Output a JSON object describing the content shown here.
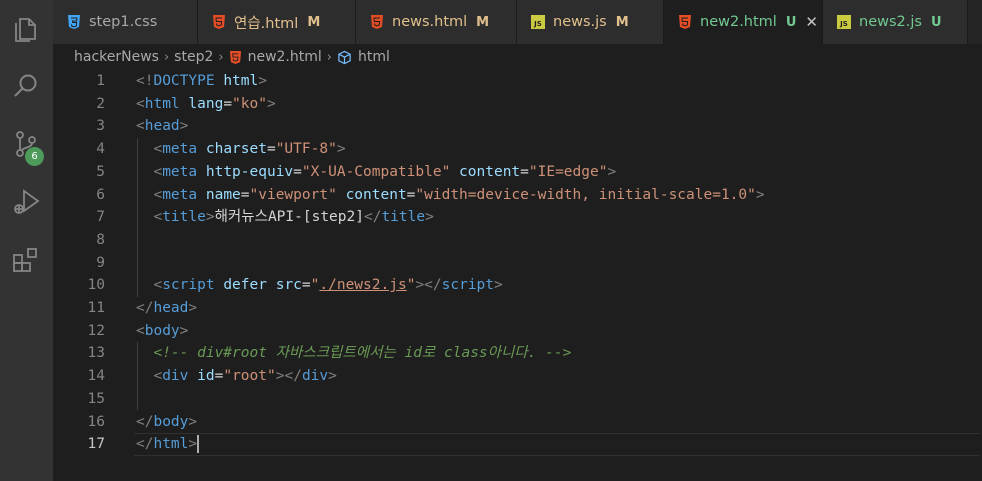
{
  "activity_bar": {
    "items": [
      {
        "icon": "explorer-icon"
      },
      {
        "icon": "search-icon"
      },
      {
        "icon": "source-control-icon",
        "badge": "6"
      },
      {
        "icon": "run-debug-icon"
      },
      {
        "icon": "extensions-icon"
      }
    ]
  },
  "tabs": [
    {
      "name": "step1.css",
      "status": "",
      "type": "css",
      "color": "#a9a9a9"
    },
    {
      "name": "연습.html",
      "status": "M",
      "type": "html",
      "color": "#e2c08d"
    },
    {
      "name": "news.html",
      "status": "M",
      "type": "html",
      "color": "#e2c08d"
    },
    {
      "name": "news.js",
      "status": "M",
      "type": "js",
      "color": "#e2c08d"
    },
    {
      "name": "new2.html",
      "status": "U",
      "type": "html",
      "color": "#73c991",
      "active": true
    },
    {
      "name": "news2.js",
      "status": "U",
      "type": "js",
      "color": "#73c991"
    }
  ],
  "colors": {
    "modified": "#e2c08d",
    "untracked": "#73c991",
    "html_icon": "#e44d26",
    "js_icon": "#cbcb41",
    "css_icon": "#42a5f5"
  },
  "breadcrumb": [
    "hackerNews",
    "step2",
    "new2.html",
    "html"
  ],
  "lines": [
    {
      "n": "1",
      "parts": [
        {
          "c": "p",
          "v": "<!"
        },
        {
          "c": "t",
          "v": "DOCTYPE"
        },
        {
          "c": "x",
          "v": " "
        },
        {
          "c": "a",
          "v": "html"
        },
        {
          "c": "p",
          "v": ">"
        }
      ]
    },
    {
      "n": "2",
      "parts": [
        {
          "c": "p",
          "v": "<"
        },
        {
          "c": "t",
          "v": "html"
        },
        {
          "c": "x",
          "v": " "
        },
        {
          "c": "a",
          "v": "lang"
        },
        {
          "c": "x",
          "v": "="
        },
        {
          "c": "s",
          "v": "\"ko\""
        },
        {
          "c": "p",
          "v": ">"
        }
      ]
    },
    {
      "n": "3",
      "parts": [
        {
          "c": "p",
          "v": "<"
        },
        {
          "c": "t",
          "v": "head"
        },
        {
          "c": "p",
          "v": ">"
        }
      ]
    },
    {
      "n": "4",
      "parts": [
        {
          "c": "x",
          "v": "  "
        },
        {
          "c": "p",
          "v": "<"
        },
        {
          "c": "t",
          "v": "meta"
        },
        {
          "c": "x",
          "v": " "
        },
        {
          "c": "a",
          "v": "charset"
        },
        {
          "c": "x",
          "v": "="
        },
        {
          "c": "s",
          "v": "\"UTF-8\""
        },
        {
          "c": "p",
          "v": ">"
        }
      ]
    },
    {
      "n": "5",
      "parts": [
        {
          "c": "x",
          "v": "  "
        },
        {
          "c": "p",
          "v": "<"
        },
        {
          "c": "t",
          "v": "meta"
        },
        {
          "c": "x",
          "v": " "
        },
        {
          "c": "a",
          "v": "http-equiv"
        },
        {
          "c": "x",
          "v": "="
        },
        {
          "c": "s",
          "v": "\"X-UA-Compatible\""
        },
        {
          "c": "x",
          "v": " "
        },
        {
          "c": "a",
          "v": "content"
        },
        {
          "c": "x",
          "v": "="
        },
        {
          "c": "s",
          "v": "\"IE=edge\""
        },
        {
          "c": "p",
          "v": ">"
        }
      ]
    },
    {
      "n": "6",
      "parts": [
        {
          "c": "x",
          "v": "  "
        },
        {
          "c": "p",
          "v": "<"
        },
        {
          "c": "t",
          "v": "meta"
        },
        {
          "c": "x",
          "v": " "
        },
        {
          "c": "a",
          "v": "name"
        },
        {
          "c": "x",
          "v": "="
        },
        {
          "c": "s",
          "v": "\"viewport\""
        },
        {
          "c": "x",
          "v": " "
        },
        {
          "c": "a",
          "v": "content"
        },
        {
          "c": "x",
          "v": "="
        },
        {
          "c": "s",
          "v": "\"width=device-width, initial-scale=1.0\""
        },
        {
          "c": "p",
          "v": ">"
        }
      ]
    },
    {
      "n": "7",
      "parts": [
        {
          "c": "x",
          "v": "  "
        },
        {
          "c": "p",
          "v": "<"
        },
        {
          "c": "t",
          "v": "title"
        },
        {
          "c": "p",
          "v": ">"
        },
        {
          "c": "x",
          "v": "해커뉴스API-[step2]"
        },
        {
          "c": "p",
          "v": "</"
        },
        {
          "c": "t",
          "v": "title"
        },
        {
          "c": "p",
          "v": ">"
        }
      ]
    },
    {
      "n": "8",
      "parts": []
    },
    {
      "n": "9",
      "parts": []
    },
    {
      "n": "10",
      "parts": [
        {
          "c": "x",
          "v": "  "
        },
        {
          "c": "p",
          "v": "<"
        },
        {
          "c": "t",
          "v": "script"
        },
        {
          "c": "x",
          "v": " "
        },
        {
          "c": "a",
          "v": "defer"
        },
        {
          "c": "x",
          "v": " "
        },
        {
          "c": "a",
          "v": "src"
        },
        {
          "c": "x",
          "v": "="
        },
        {
          "c": "s",
          "v": "\""
        },
        {
          "c": "s u",
          "v": "./news2.js"
        },
        {
          "c": "s",
          "v": "\""
        },
        {
          "c": "p",
          "v": "></"
        },
        {
          "c": "t",
          "v": "script"
        },
        {
          "c": "p",
          "v": ">"
        }
      ]
    },
    {
      "n": "11",
      "parts": [
        {
          "c": "p",
          "v": "</"
        },
        {
          "c": "t",
          "v": "head"
        },
        {
          "c": "p",
          "v": ">"
        }
      ]
    },
    {
      "n": "12",
      "parts": [
        {
          "c": "p",
          "v": "<"
        },
        {
          "c": "t",
          "v": "body"
        },
        {
          "c": "p",
          "v": ">"
        }
      ]
    },
    {
      "n": "13",
      "parts": [
        {
          "c": "x",
          "v": "  "
        },
        {
          "c": "c",
          "v": "<!-- div#root 자바스크립트에서는 id로 class아니다. -->"
        }
      ]
    },
    {
      "n": "14",
      "parts": [
        {
          "c": "x",
          "v": "  "
        },
        {
          "c": "p",
          "v": "<"
        },
        {
          "c": "t",
          "v": "div"
        },
        {
          "c": "x",
          "v": " "
        },
        {
          "c": "a",
          "v": "id"
        },
        {
          "c": "x",
          "v": "="
        },
        {
          "c": "s",
          "v": "\"root\""
        },
        {
          "c": "p",
          "v": "></"
        },
        {
          "c": "t",
          "v": "div"
        },
        {
          "c": "p",
          "v": ">"
        }
      ]
    },
    {
      "n": "15",
      "parts": []
    },
    {
      "n": "16",
      "parts": [
        {
          "c": "p",
          "v": "</"
        },
        {
          "c": "t",
          "v": "body"
        },
        {
          "c": "p",
          "v": ">"
        }
      ]
    },
    {
      "n": "17",
      "parts": [
        {
          "c": "p",
          "v": "</"
        },
        {
          "c": "t",
          "v": "html"
        },
        {
          "c": "p",
          "v": ">"
        }
      ],
      "current": true
    }
  ]
}
